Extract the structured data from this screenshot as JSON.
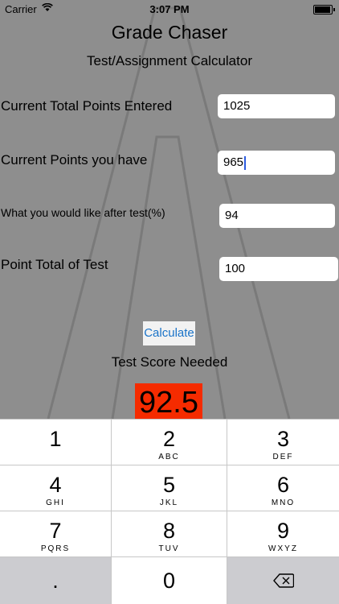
{
  "status_bar": {
    "carrier": "Carrier",
    "time": "3:07 PM"
  },
  "app": {
    "title": "Grade Chaser",
    "subtitle": "Test/Assignment Calculator"
  },
  "form": {
    "total_points": {
      "label": "Current Total Points Entered",
      "value": "1025"
    },
    "points_have": {
      "label": "Current Points you have",
      "value": "965"
    },
    "target_pct": {
      "label": "What you would like after test(%)",
      "value": "94"
    },
    "test_total": {
      "label": "Point Total of Test",
      "value": "100"
    }
  },
  "calculate_label": "Calculate",
  "result": {
    "label": "Test Score Needed",
    "value": "92.5",
    "color": "#f52b00"
  },
  "keypad": {
    "keys": [
      {
        "digit": "1",
        "letters": ""
      },
      {
        "digit": "2",
        "letters": "ABC"
      },
      {
        "digit": "3",
        "letters": "DEF"
      },
      {
        "digit": "4",
        "letters": "GHI"
      },
      {
        "digit": "5",
        "letters": "JKL"
      },
      {
        "digit": "6",
        "letters": "MNO"
      },
      {
        "digit": "7",
        "letters": "PQRS"
      },
      {
        "digit": "8",
        "letters": "TUV"
      },
      {
        "digit": "9",
        "letters": "WXYZ"
      }
    ],
    "decimal": ".",
    "zero": "0",
    "delete_icon": "backspace-icon"
  }
}
